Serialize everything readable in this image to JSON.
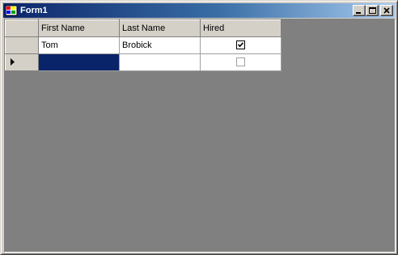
{
  "window": {
    "title": "Form1",
    "icon": "app-form-icon",
    "buttons": [
      "minimize-icon",
      "maximize-icon",
      "close-icon"
    ]
  },
  "grid": {
    "columns": [
      "First Name",
      "Last Name",
      "Hired"
    ],
    "rows": [
      {
        "first_name": "Tom",
        "last_name": "Brobick",
        "hired": true
      },
      {
        "first_name": "",
        "last_name": "",
        "hired": false,
        "is_new_row": true,
        "selected_column": "first_name"
      }
    ],
    "current_row_indicator": "right-triangle-icon"
  },
  "colors": {
    "title_gradient_start": "#0a246a",
    "selection": "#0a246a",
    "client_background": "#808080",
    "face": "#d4d0c8"
  }
}
